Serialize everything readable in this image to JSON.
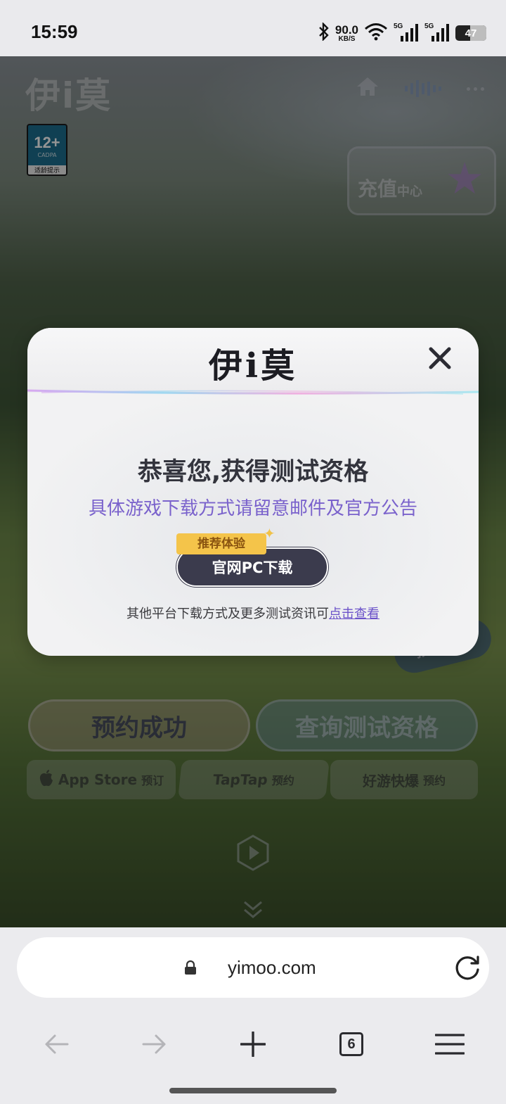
{
  "status_bar": {
    "time": "15:59",
    "net_speed_value": "90.0",
    "net_speed_unit": "KB/S",
    "signal_1_tag": "5G",
    "signal_2_tag": "5G",
    "battery": "47"
  },
  "background_page": {
    "logo": "伊i莫",
    "age_rating": "12+",
    "age_rating_org": "CADPA",
    "age_rating_label": "适龄提示",
    "recharge_main": "充值",
    "recharge_small": "中心",
    "reward_tag": "预约奖励",
    "reserved_button": "预约成功",
    "query_button": "查询测试资格",
    "stores": [
      {
        "name": "App Store",
        "action": "预订"
      },
      {
        "name": "TapTap",
        "action": "预约"
      },
      {
        "name": "好游快爆",
        "action": "预约"
      }
    ]
  },
  "modal": {
    "logo": "伊i莫",
    "title": "恭喜您,获得测试资格",
    "subtitle": "具体游戏下载方式请留意邮件及官方公告",
    "recommend_tag": "推荐体验",
    "download_button": "官网PC下载",
    "footer_text": "其他平台下载方式及更多测试资讯可",
    "footer_link": "点击查看"
  },
  "browser": {
    "url": "yimoo.com",
    "tab_count": "6"
  },
  "colors": {
    "accent_purple": "#7a62cc",
    "button_dark": "#3b3b4d",
    "tag_yellow": "#f4c44a"
  }
}
